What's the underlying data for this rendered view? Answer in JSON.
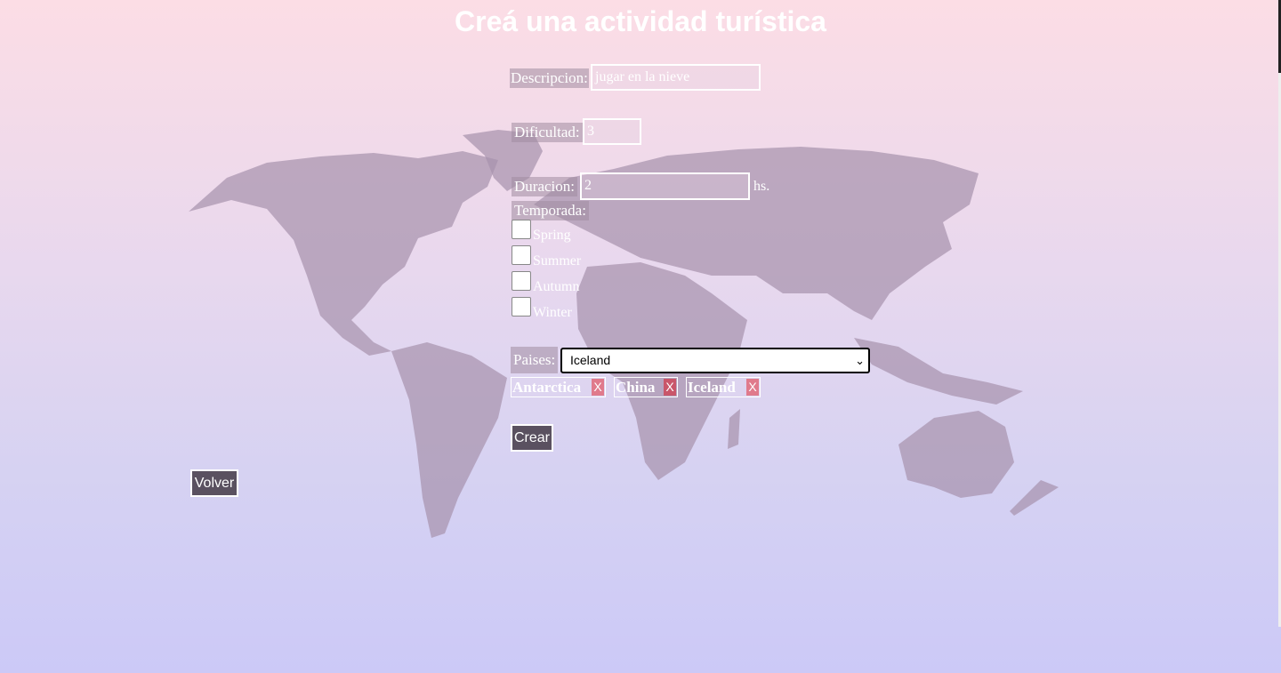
{
  "title": "Creá una actividad turística",
  "form": {
    "descripcion": {
      "label": "Descripcion:",
      "value": "jugar en la nieve"
    },
    "dificultad": {
      "label": "Dificultad:",
      "value": "3"
    },
    "duracion": {
      "label": "Duracion:",
      "value": "2",
      "unit": "hs."
    },
    "temporada": {
      "label": "Temporada:",
      "options": [
        {
          "label": "Spring",
          "checked": false
        },
        {
          "label": "Summer",
          "checked": false
        },
        {
          "label": "Autumn",
          "checked": false
        },
        {
          "label": "Winter",
          "checked": false
        }
      ]
    },
    "paises": {
      "label": "Paises:",
      "selected": "Iceland"
    },
    "selected_countries": [
      {
        "name": "Antarctica",
        "remove": "X"
      },
      {
        "name": "China",
        "remove": "X"
      },
      {
        "name": "Iceland",
        "remove": "X"
      }
    ],
    "submit_label": "Crear"
  },
  "back_label": "Volver",
  "icons": {
    "dropdown": "chevron-down-icon",
    "background": "world-map-icon"
  },
  "colors": {
    "button_bg": "#5a5160",
    "remove_bg": "#e07a8c",
    "map": "#a893ad"
  }
}
